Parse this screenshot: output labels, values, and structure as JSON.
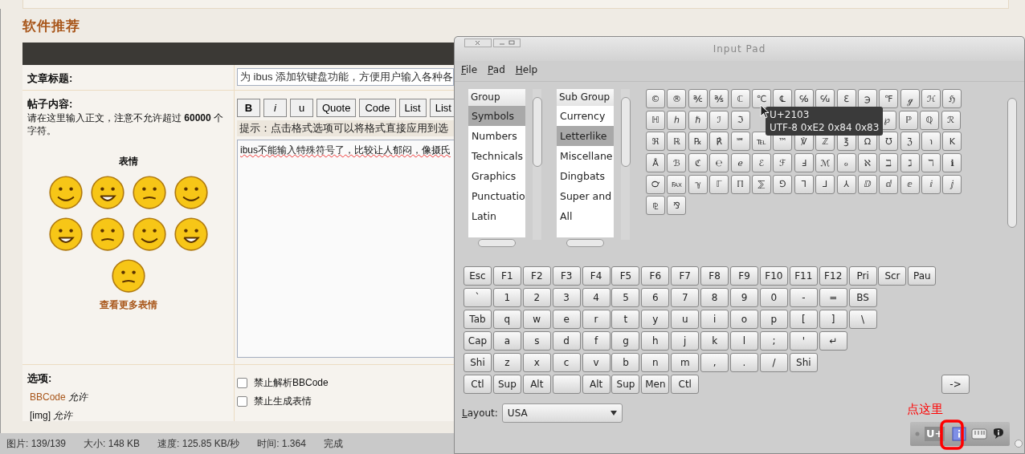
{
  "page": {
    "heading": "软件推荐",
    "form": {
      "title_label": "文章标题:",
      "title_value": "为 ibus 添加软键盘功能，方便用户输入各种各",
      "content_label": "帖子内容:",
      "content_note": "请在这里输入正文，注意不允许超过 **60000** 个字符。",
      "emoticons_heading": "表情",
      "more_emoticons": "查看更多表情",
      "toolbar": [
        {
          "label": "B",
          "kind": "bold"
        },
        {
          "label": "i",
          "kind": "italic"
        },
        {
          "label": "u",
          "kind": "plain"
        },
        {
          "label": "Quote",
          "kind": "plain"
        },
        {
          "label": "Code",
          "kind": "plain"
        },
        {
          "label": "List",
          "kind": "plain"
        },
        {
          "label": "List",
          "kind": "plain"
        }
      ],
      "hint": "提示：点击格式选项可以将格式直接应用到选",
      "body": "ibus不能输入特殊符号了，比较让人郁闷，像摄氏",
      "options_label": "选项:",
      "option_notes": [
        {
          "kind": "link",
          "label": "BBCode",
          "status": "允许"
        },
        {
          "kind": "plain",
          "label": "[img]",
          "status": "允许"
        }
      ],
      "checkboxes": [
        {
          "label": "禁止解析BBCode",
          "checked": false
        },
        {
          "label": "禁止生成表情",
          "checked": false
        }
      ]
    }
  },
  "status_bar": [
    "图片: 139/139",
    "大小: 148 KB",
    "速度: 125.85 KB/秒",
    "时间: 1.364",
    "完成"
  ],
  "input_pad": {
    "title": "Input Pad",
    "menu": [
      "File",
      "Pad",
      "Help"
    ],
    "group_list": {
      "header": "Group",
      "items": [
        {
          "label": "Symbols",
          "selected": true
        },
        {
          "label": "Numbers",
          "selected": false
        },
        {
          "label": "Technicals",
          "selected": false
        },
        {
          "label": "Graphics",
          "selected": false
        },
        {
          "label": "Punctuatio",
          "selected": false
        },
        {
          "label": "Latin",
          "selected": false
        }
      ]
    },
    "subgroup_list": {
      "header": "Sub Group",
      "items": [
        {
          "label": "Currency",
          "selected": false
        },
        {
          "label": "Letterlike",
          "selected": true
        },
        {
          "label": "Miscellane",
          "selected": false
        },
        {
          "label": "Dingbats",
          "selected": false
        },
        {
          "label": "Super and",
          "selected": false
        },
        {
          "label": "All",
          "selected": false
        }
      ]
    },
    "symbols": [
      {
        "keys": [
          "©",
          "®",
          "℀",
          "℁",
          "ℂ",
          "℃",
          "℄",
          "℅",
          "℆",
          "ℇ",
          "℈",
          "℉",
          "ℊ",
          "ℋ",
          "ℌ"
        ]
      },
      {
        "keys": [
          "ℍ",
          "ℎ",
          "ℏ",
          "ℐ",
          "ℑ"
        ],
        "keys_after_tooltip": [
          "℘",
          "ℙ",
          "ℚ",
          "ℛ"
        ]
      },
      {
        "keys": [
          "ℜ",
          "ℝ",
          "℞",
          "℟",
          "℠",
          "℡",
          "™",
          "℣",
          "ℤ",
          "℥",
          "Ω",
          "℧",
          "ℨ",
          "℩",
          "K"
        ]
      },
      {
        "keys": [
          "Å",
          "ℬ",
          "ℭ",
          "℮",
          "ℯ",
          "ℰ",
          "ℱ",
          "Ⅎ",
          "ℳ",
          "ℴ",
          "ℵ",
          "ℶ",
          "ℷ",
          "ℸ",
          "ℹ"
        ]
      },
      {
        "keys": [
          "℺",
          "℻",
          "ℽ",
          "ℾ",
          "ℿ",
          "⅀",
          "⅁",
          "⅂",
          "⅃",
          "⅄",
          "ⅅ",
          "ⅆ",
          "ⅇ",
          "ⅈ",
          "ⅉ"
        ]
      },
      {
        "keys": [
          "⅊",
          "⅋"
        ]
      }
    ],
    "tooltip": [
      "U+2103",
      "UTF-8 0xE2 0x84 0x83"
    ],
    "keyboard": [
      [
        {
          "label": "Esc"
        },
        {
          "label": "F1"
        },
        {
          "label": "F2"
        },
        {
          "label": "F3"
        },
        {
          "label": "F4"
        },
        {
          "label": "F5"
        },
        {
          "label": "F6"
        },
        {
          "label": "F7"
        },
        {
          "label": "F8"
        },
        {
          "label": "F9"
        },
        {
          "label": "F10"
        },
        {
          "label": "F11"
        },
        {
          "label": "F12"
        },
        {
          "label": "Pri"
        },
        {
          "label": "Scr"
        },
        {
          "label": "Pau"
        }
      ],
      [
        {
          "label": "`"
        },
        {
          "label": "1"
        },
        {
          "label": "2"
        },
        {
          "label": "3"
        },
        {
          "label": "4"
        },
        {
          "label": "5"
        },
        {
          "label": "6"
        },
        {
          "label": "7"
        },
        {
          "label": "8"
        },
        {
          "label": "9"
        },
        {
          "label": "0"
        },
        {
          "label": "-"
        },
        {
          "label": "="
        },
        {
          "label": "BS"
        }
      ],
      [
        {
          "label": "Tab"
        },
        {
          "label": "q"
        },
        {
          "label": "w"
        },
        {
          "label": "e"
        },
        {
          "label": "r"
        },
        {
          "label": "t"
        },
        {
          "label": "y"
        },
        {
          "label": "u"
        },
        {
          "label": "i"
        },
        {
          "label": "o"
        },
        {
          "label": "p"
        },
        {
          "label": "["
        },
        {
          "label": "]"
        },
        {
          "label": "\\"
        }
      ],
      [
        {
          "label": "Cap"
        },
        {
          "label": "a"
        },
        {
          "label": "s"
        },
        {
          "label": "d"
        },
        {
          "label": "f"
        },
        {
          "label": "g"
        },
        {
          "label": "h"
        },
        {
          "label": "j"
        },
        {
          "label": "k"
        },
        {
          "label": "l"
        },
        {
          "label": ";"
        },
        {
          "label": "'"
        },
        {
          "label": "↵"
        }
      ],
      [
        {
          "label": "Shi"
        },
        {
          "label": "z"
        },
        {
          "label": "x"
        },
        {
          "label": "c"
        },
        {
          "label": "v"
        },
        {
          "label": "b"
        },
        {
          "label": "n"
        },
        {
          "label": "m"
        },
        {
          "label": ","
        },
        {
          "label": "."
        },
        {
          "label": "/"
        },
        {
          "label": "Shi"
        }
      ],
      [
        {
          "label": "Ctl"
        },
        {
          "label": "Sup"
        },
        {
          "label": "Alt"
        },
        {
          "kind": "space"
        },
        {
          "label": "Alt"
        },
        {
          "label": "Sup"
        },
        {
          "label": "Men"
        },
        {
          "label": "Ctl"
        }
      ]
    ],
    "arrow_key": "->",
    "layout_label": "Layout:",
    "layout_value": "USA",
    "annotation": "点这里",
    "toolbar_text": "U+"
  }
}
